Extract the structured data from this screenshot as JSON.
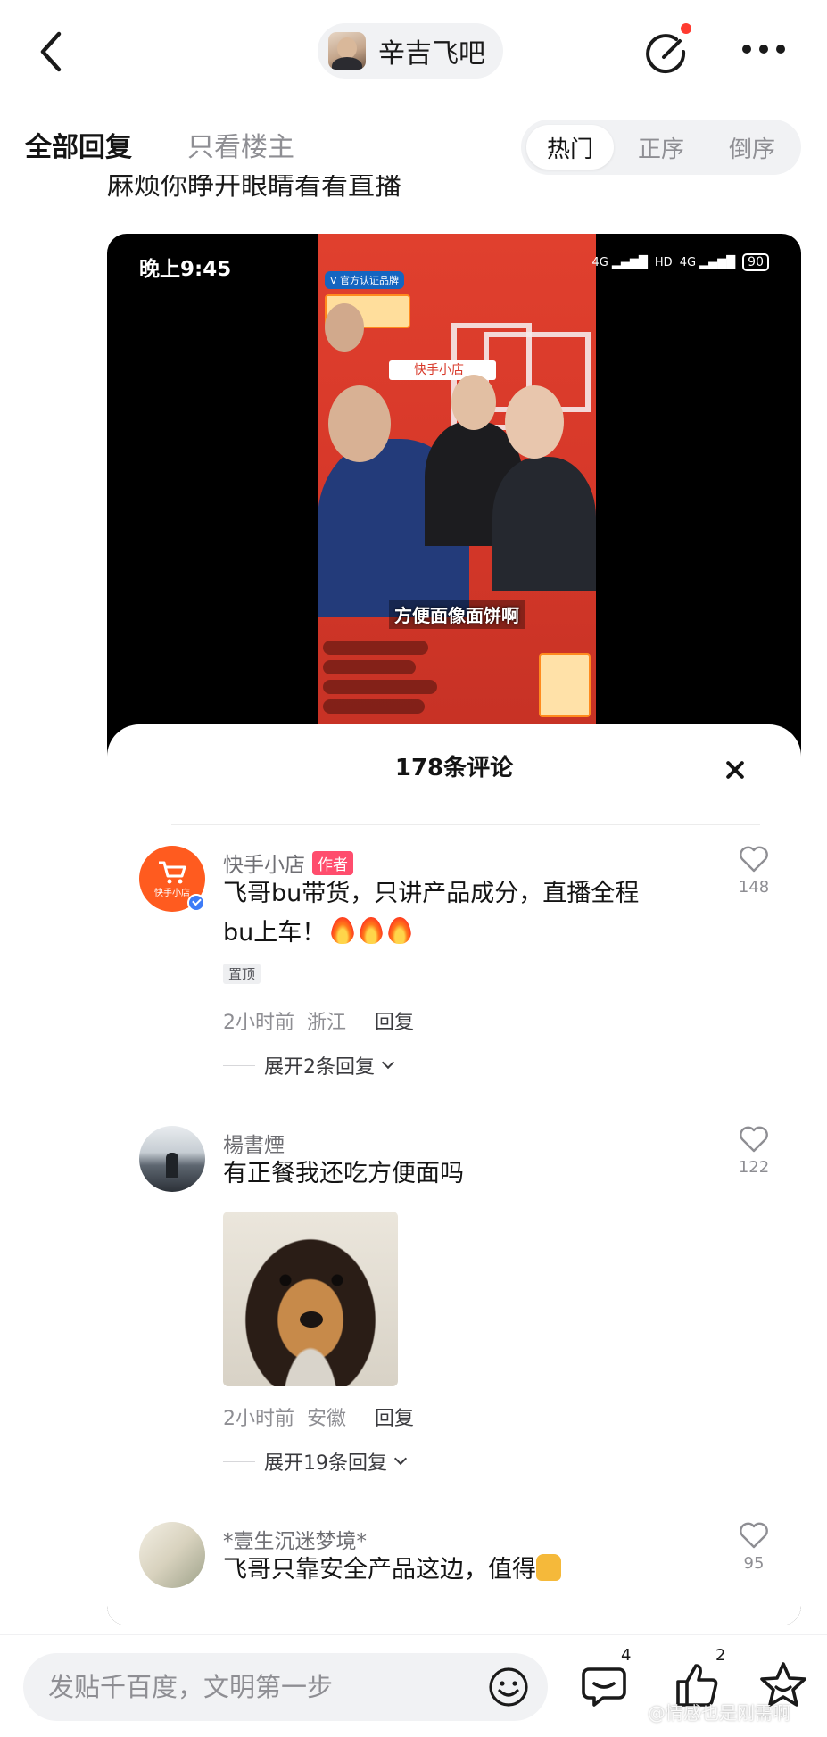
{
  "header": {
    "back_icon": "chevron-left-icon",
    "forum_name": "辛吉飞吧",
    "compose_icon": "compose-icon",
    "more_icon": "more-dots-icon"
  },
  "tabs": {
    "all_replies": "全部回复",
    "owner_only": "只看楼主",
    "sort": [
      "热门",
      "正序",
      "倒序"
    ],
    "sort_active": "热门"
  },
  "post": {
    "text": "麻烦你睁开眼睛看看直播"
  },
  "screenshot": {
    "status_time": "晚上9:45",
    "battery": "90",
    "live_caption": "方便面像面饼啊",
    "shop_label": "快手小店",
    "comments_title": "178条评论",
    "comments": [
      {
        "user": "快手小店",
        "author_tag": "作者",
        "text_line1": "飞哥bu带货，只讲产品成分，直播全程",
        "text_line2": "bu上车！",
        "pinned": "置顶",
        "time": "2小时前",
        "location": "浙江",
        "reply": "回复",
        "expand": "展开2条回复",
        "likes": "148"
      },
      {
        "user": "楊書煙",
        "text": "有正餐我还吃方便面吗",
        "time": "2小时前",
        "location": "安徽",
        "reply": "回复",
        "expand": "展开19条回复",
        "likes": "122"
      },
      {
        "user": "*壹生沉迷梦境*",
        "text": "飞哥只靠安全产品这边，值得",
        "likes": "95"
      }
    ]
  },
  "bottom_bar": {
    "input_placeholder": "发贴千百度，文明第一步",
    "comment_count": "4",
    "like_count": "2",
    "watermark": "@情感也是刚需啊"
  },
  "colors": {
    "accent_red": "#ff3b30",
    "live_bg": "#d8392a",
    "author_tag": "#ff4d6d",
    "verified_blue": "#3d7bf7"
  }
}
